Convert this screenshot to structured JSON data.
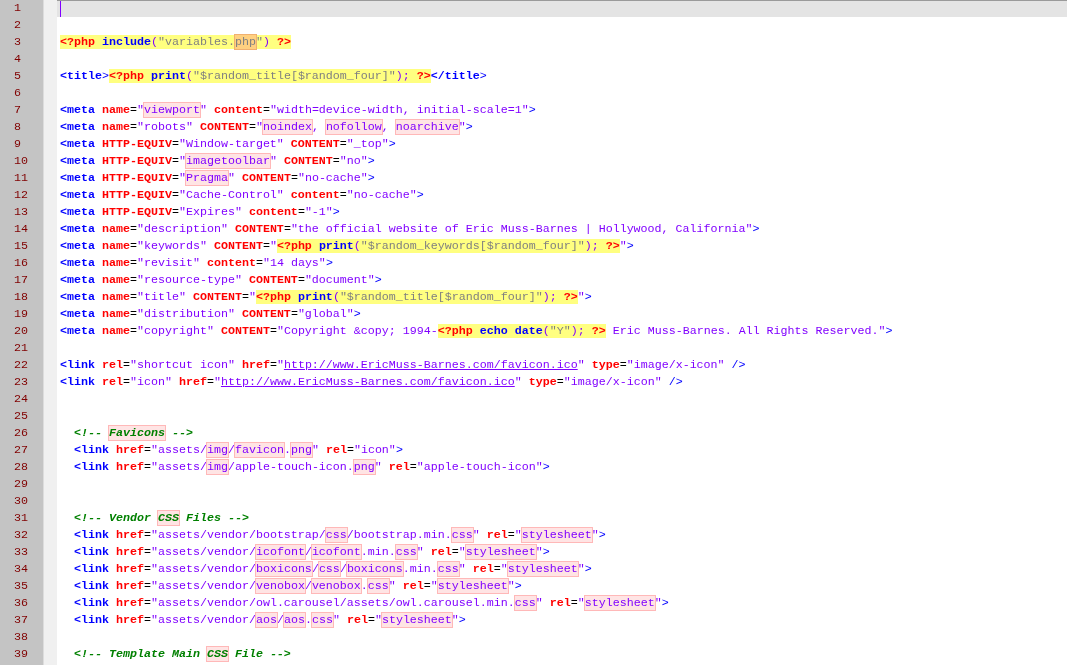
{
  "editor": {
    "lines": [
      {
        "number": "1",
        "current": true
      },
      {
        "number": "2",
        "current": false
      },
      {
        "number": "3",
        "current": false,
        "tokens": [
          {
            "text": "<?php ",
            "kind": "php"
          },
          {
            "text": "include",
            "kind": "php_kw"
          },
          {
            "text": "(",
            "kind": "php_punct"
          },
          {
            "text": "\"variables.",
            "kind": "php_str"
          },
          {
            "text": "php",
            "kind": "php_flag"
          },
          {
            "text": "\"",
            "kind": "php_str"
          },
          {
            "text": ") ",
            "kind": "php_punct"
          },
          {
            "text": "?>",
            "kind": "php"
          }
        ]
      },
      {
        "number": "4",
        "current": false
      },
      {
        "number": "5",
        "current": false,
        "tokens": [
          {
            "text": "<title",
            "kind": "tag"
          },
          {
            "text": ">",
            "kind": "punct"
          },
          {
            "text": "<?php ",
            "kind": "php"
          },
          {
            "text": "print",
            "kind": "php_kw"
          },
          {
            "text": "(",
            "kind": "php_punct"
          },
          {
            "text": "\"$random_title[$random_four]\"",
            "kind": "php_str"
          },
          {
            "text": "); ",
            "kind": "php_punct"
          },
          {
            "text": "?>",
            "kind": "php"
          },
          {
            "text": "</title",
            "kind": "tag"
          },
          {
            "text": ">",
            "kind": "punct"
          }
        ]
      },
      {
        "number": "6",
        "current": false
      },
      {
        "number": "7",
        "current": false,
        "tokens": [
          {
            "text": "<meta",
            "kind": "tag"
          },
          {
            "text": " name",
            "kind": "attr"
          },
          {
            "text": "=",
            "kind": "eq"
          },
          {
            "text": "\"",
            "kind": "val"
          },
          {
            "text": "viewport",
            "kind": "flag"
          },
          {
            "text": "\"",
            "kind": "val"
          },
          {
            "text": " content",
            "kind": "attr"
          },
          {
            "text": "=",
            "kind": "eq"
          },
          {
            "text": "\"width=device-width, initial-scale=1\"",
            "kind": "val"
          },
          {
            "text": ">",
            "kind": "punct"
          }
        ]
      },
      {
        "number": "8",
        "current": false,
        "tokens": [
          {
            "text": "<meta",
            "kind": "tag"
          },
          {
            "text": " name",
            "kind": "attr"
          },
          {
            "text": "=",
            "kind": "eq"
          },
          {
            "text": "\"robots\"",
            "kind": "val"
          },
          {
            "text": " CONTENT",
            "kind": "attr"
          },
          {
            "text": "=",
            "kind": "eq"
          },
          {
            "text": "\"",
            "kind": "val"
          },
          {
            "text": "noindex",
            "kind": "flag"
          },
          {
            "text": ", ",
            "kind": "val"
          },
          {
            "text": "nofollow",
            "kind": "flag"
          },
          {
            "text": ", ",
            "kind": "val"
          },
          {
            "text": "noarchive",
            "kind": "flag"
          },
          {
            "text": "\"",
            "kind": "val"
          },
          {
            "text": ">",
            "kind": "punct"
          }
        ]
      },
      {
        "number": "9",
        "current": false,
        "tokens": [
          {
            "text": "<meta",
            "kind": "tag"
          },
          {
            "text": " HTTP-EQUIV",
            "kind": "attr"
          },
          {
            "text": "=",
            "kind": "eq"
          },
          {
            "text": "\"Window-target\"",
            "kind": "val"
          },
          {
            "text": " CONTENT",
            "kind": "attr"
          },
          {
            "text": "=",
            "kind": "eq"
          },
          {
            "text": "\"_top\"",
            "kind": "val"
          },
          {
            "text": ">",
            "kind": "punct"
          }
        ]
      },
      {
        "number": "10",
        "current": false,
        "tokens": [
          {
            "text": "<meta",
            "kind": "tag"
          },
          {
            "text": " HTTP-EQUIV",
            "kind": "attr"
          },
          {
            "text": "=",
            "kind": "eq"
          },
          {
            "text": "\"",
            "kind": "val"
          },
          {
            "text": "imagetoolbar",
            "kind": "flag"
          },
          {
            "text": "\"",
            "kind": "val"
          },
          {
            "text": " CONTENT",
            "kind": "attr"
          },
          {
            "text": "=",
            "kind": "eq"
          },
          {
            "text": "\"no\"",
            "kind": "val"
          },
          {
            "text": ">",
            "kind": "punct"
          }
        ]
      },
      {
        "number": "11",
        "current": false,
        "tokens": [
          {
            "text": "<meta",
            "kind": "tag"
          },
          {
            "text": " HTTP-EQUIV",
            "kind": "attr"
          },
          {
            "text": "=",
            "kind": "eq"
          },
          {
            "text": "\"",
            "kind": "val"
          },
          {
            "text": "Pragma",
            "kind": "flag"
          },
          {
            "text": "\"",
            "kind": "val"
          },
          {
            "text": " CONTENT",
            "kind": "attr"
          },
          {
            "text": "=",
            "kind": "eq"
          },
          {
            "text": "\"no-cache\"",
            "kind": "val"
          },
          {
            "text": ">",
            "kind": "punct"
          }
        ]
      },
      {
        "number": "12",
        "current": false,
        "tokens": [
          {
            "text": "<meta",
            "kind": "tag"
          },
          {
            "text": " HTTP-EQUIV",
            "kind": "attr"
          },
          {
            "text": "=",
            "kind": "eq"
          },
          {
            "text": "\"Cache-Control\"",
            "kind": "val"
          },
          {
            "text": " content",
            "kind": "attr"
          },
          {
            "text": "=",
            "kind": "eq"
          },
          {
            "text": "\"no-cache\"",
            "kind": "val"
          },
          {
            "text": ">",
            "kind": "punct"
          }
        ]
      },
      {
        "number": "13",
        "current": false,
        "tokens": [
          {
            "text": "<meta",
            "kind": "tag"
          },
          {
            "text": " HTTP-EQUIV",
            "kind": "attr"
          },
          {
            "text": "=",
            "kind": "eq"
          },
          {
            "text": "\"Expires\"",
            "kind": "val"
          },
          {
            "text": " content",
            "kind": "attr"
          },
          {
            "text": "=",
            "kind": "eq"
          },
          {
            "text": "\"-1\"",
            "kind": "val"
          },
          {
            "text": ">",
            "kind": "punct"
          }
        ]
      },
      {
        "number": "14",
        "current": false,
        "tokens": [
          {
            "text": "<meta",
            "kind": "tag"
          },
          {
            "text": " name",
            "kind": "attr"
          },
          {
            "text": "=",
            "kind": "eq"
          },
          {
            "text": "\"description\"",
            "kind": "val"
          },
          {
            "text": " CONTENT",
            "kind": "attr"
          },
          {
            "text": "=",
            "kind": "eq"
          },
          {
            "text": "\"the official website of Eric Muss-Barnes | Hollywood, California\"",
            "kind": "val"
          },
          {
            "text": ">",
            "kind": "punct"
          }
        ]
      },
      {
        "number": "15",
        "current": false,
        "tokens": [
          {
            "text": "<meta",
            "kind": "tag"
          },
          {
            "text": " name",
            "kind": "attr"
          },
          {
            "text": "=",
            "kind": "eq"
          },
          {
            "text": "\"keywords\"",
            "kind": "val"
          },
          {
            "text": " CONTENT",
            "kind": "attr"
          },
          {
            "text": "=",
            "kind": "eq"
          },
          {
            "text": "\"",
            "kind": "val"
          },
          {
            "text": "<?php ",
            "kind": "php"
          },
          {
            "text": "print",
            "kind": "php_kw"
          },
          {
            "text": "(",
            "kind": "php_punct"
          },
          {
            "text": "\"$random_keywords[$random_four]\"",
            "kind": "php_str"
          },
          {
            "text": "); ",
            "kind": "php_punct"
          },
          {
            "text": "?>",
            "kind": "php"
          },
          {
            "text": "\"",
            "kind": "val"
          },
          {
            "text": ">",
            "kind": "punct"
          }
        ]
      },
      {
        "number": "16",
        "current": false,
        "tokens": [
          {
            "text": "<meta",
            "kind": "tag"
          },
          {
            "text": " name",
            "kind": "attr"
          },
          {
            "text": "=",
            "kind": "eq"
          },
          {
            "text": "\"revisit\"",
            "kind": "val"
          },
          {
            "text": " content",
            "kind": "attr"
          },
          {
            "text": "=",
            "kind": "eq"
          },
          {
            "text": "\"14 days\"",
            "kind": "val"
          },
          {
            "text": ">",
            "kind": "punct"
          }
        ]
      },
      {
        "number": "17",
        "current": false,
        "tokens": [
          {
            "text": "<meta",
            "kind": "tag"
          },
          {
            "text": " name",
            "kind": "attr"
          },
          {
            "text": "=",
            "kind": "eq"
          },
          {
            "text": "\"resource-type\"",
            "kind": "val"
          },
          {
            "text": " CONTENT",
            "kind": "attr"
          },
          {
            "text": "=",
            "kind": "eq"
          },
          {
            "text": "\"document\"",
            "kind": "val"
          },
          {
            "text": ">",
            "kind": "punct"
          }
        ]
      },
      {
        "number": "18",
        "current": false,
        "tokens": [
          {
            "text": "<meta",
            "kind": "tag"
          },
          {
            "text": " name",
            "kind": "attr"
          },
          {
            "text": "=",
            "kind": "eq"
          },
          {
            "text": "\"title\"",
            "kind": "val"
          },
          {
            "text": " CONTENT",
            "kind": "attr"
          },
          {
            "text": "=",
            "kind": "eq"
          },
          {
            "text": "\"",
            "kind": "val"
          },
          {
            "text": "<?php ",
            "kind": "php"
          },
          {
            "text": "print",
            "kind": "php_kw"
          },
          {
            "text": "(",
            "kind": "php_punct"
          },
          {
            "text": "\"$random_title[$random_four]\"",
            "kind": "php_str"
          },
          {
            "text": "); ",
            "kind": "php_punct"
          },
          {
            "text": "?>",
            "kind": "php"
          },
          {
            "text": "\"",
            "kind": "val"
          },
          {
            "text": ">",
            "kind": "punct"
          }
        ]
      },
      {
        "number": "19",
        "current": false,
        "tokens": [
          {
            "text": "<meta",
            "kind": "tag"
          },
          {
            "text": " name",
            "kind": "attr"
          },
          {
            "text": "=",
            "kind": "eq"
          },
          {
            "text": "\"distribution\"",
            "kind": "val"
          },
          {
            "text": " CONTENT",
            "kind": "attr"
          },
          {
            "text": "=",
            "kind": "eq"
          },
          {
            "text": "\"global\"",
            "kind": "val"
          },
          {
            "text": ">",
            "kind": "punct"
          }
        ]
      },
      {
        "number": "20",
        "current": false,
        "tokens": [
          {
            "text": "<meta",
            "kind": "tag"
          },
          {
            "text": " name",
            "kind": "attr"
          },
          {
            "text": "=",
            "kind": "eq"
          },
          {
            "text": "\"copyright\"",
            "kind": "val"
          },
          {
            "text": " CONTENT",
            "kind": "attr"
          },
          {
            "text": "=",
            "kind": "eq"
          },
          {
            "text": "\"Copyright &copy; 1994-",
            "kind": "val"
          },
          {
            "text": "<?php ",
            "kind": "php"
          },
          {
            "text": "echo date",
            "kind": "php_kw"
          },
          {
            "text": "(",
            "kind": "php_punct"
          },
          {
            "text": "\"Y\"",
            "kind": "php_str"
          },
          {
            "text": "); ",
            "kind": "php_punct"
          },
          {
            "text": "?>",
            "kind": "php"
          },
          {
            "text": " Eric Muss-Barnes. All Rights Reserved.\"",
            "kind": "val"
          },
          {
            "text": ">",
            "kind": "punct"
          }
        ]
      },
      {
        "number": "21",
        "current": false
      },
      {
        "number": "22",
        "current": false,
        "tokens": [
          {
            "text": "<link",
            "kind": "tag"
          },
          {
            "text": " rel",
            "kind": "attr"
          },
          {
            "text": "=",
            "kind": "eq"
          },
          {
            "text": "\"shortcut icon\"",
            "kind": "val"
          },
          {
            "text": " href",
            "kind": "attr"
          },
          {
            "text": "=",
            "kind": "eq"
          },
          {
            "text": "\"",
            "kind": "val"
          },
          {
            "text": "http://www.EricMuss-Barnes.com/favicon.ico",
            "kind": "url"
          },
          {
            "text": "\"",
            "kind": "val"
          },
          {
            "text": " type",
            "kind": "attr"
          },
          {
            "text": "=",
            "kind": "eq"
          },
          {
            "text": "\"image/x-icon\"",
            "kind": "val"
          },
          {
            "text": " />",
            "kind": "punct"
          }
        ]
      },
      {
        "number": "23",
        "current": false,
        "tokens": [
          {
            "text": "<link",
            "kind": "tag"
          },
          {
            "text": " rel",
            "kind": "attr"
          },
          {
            "text": "=",
            "kind": "eq"
          },
          {
            "text": "\"icon\"",
            "kind": "val"
          },
          {
            "text": " href",
            "kind": "attr"
          },
          {
            "text": "=",
            "kind": "eq"
          },
          {
            "text": "\"",
            "kind": "val"
          },
          {
            "text": "http://www.EricMuss-Barnes.com/favicon.ico",
            "kind": "url"
          },
          {
            "text": "\"",
            "kind": "val"
          },
          {
            "text": " type",
            "kind": "attr"
          },
          {
            "text": "=",
            "kind": "eq"
          },
          {
            "text": "\"image/x-icon\"",
            "kind": "val"
          },
          {
            "text": " />",
            "kind": "punct"
          }
        ]
      },
      {
        "number": "24",
        "current": false
      },
      {
        "number": "25",
        "current": false
      },
      {
        "number": "26",
        "current": false,
        "indented": true,
        "tokens": [
          {
            "text": "<!-- ",
            "kind": "comment"
          },
          {
            "text": "Favicons",
            "kind": "comment_flag"
          },
          {
            "text": " -->",
            "kind": "comment"
          }
        ]
      },
      {
        "number": "27",
        "current": false,
        "indented": true,
        "tokens": [
          {
            "text": "<link",
            "kind": "tag"
          },
          {
            "text": " href",
            "kind": "attr"
          },
          {
            "text": "=",
            "kind": "eq"
          },
          {
            "text": "\"assets/",
            "kind": "val"
          },
          {
            "text": "img",
            "kind": "flag"
          },
          {
            "text": "/",
            "kind": "val"
          },
          {
            "text": "favicon",
            "kind": "flag"
          },
          {
            "text": ".",
            "kind": "val"
          },
          {
            "text": "png",
            "kind": "flag"
          },
          {
            "text": "\"",
            "kind": "val"
          },
          {
            "text": " rel",
            "kind": "attr"
          },
          {
            "text": "=",
            "kind": "eq"
          },
          {
            "text": "\"icon\"",
            "kind": "val"
          },
          {
            "text": ">",
            "kind": "punct"
          }
        ]
      },
      {
        "number": "28",
        "current": false,
        "indented": true,
        "tokens": [
          {
            "text": "<link",
            "kind": "tag"
          },
          {
            "text": " href",
            "kind": "attr"
          },
          {
            "text": "=",
            "kind": "eq"
          },
          {
            "text": "\"assets/",
            "kind": "val"
          },
          {
            "text": "img",
            "kind": "flag"
          },
          {
            "text": "/apple-touch-icon.",
            "kind": "val"
          },
          {
            "text": "png",
            "kind": "flag"
          },
          {
            "text": "\"",
            "kind": "val"
          },
          {
            "text": " rel",
            "kind": "attr"
          },
          {
            "text": "=",
            "kind": "eq"
          },
          {
            "text": "\"apple-touch-icon\"",
            "kind": "val"
          },
          {
            "text": ">",
            "kind": "punct"
          }
        ]
      },
      {
        "number": "29",
        "current": false
      },
      {
        "number": "30",
        "current": false
      },
      {
        "number": "31",
        "current": false,
        "indented": true,
        "tokens": [
          {
            "text": "<!-- Vendor ",
            "kind": "comment"
          },
          {
            "text": "CSS",
            "kind": "comment_flag"
          },
          {
            "text": " Files -->",
            "kind": "comment"
          }
        ]
      },
      {
        "number": "32",
        "current": false,
        "indented": true,
        "tokens": [
          {
            "text": "<link",
            "kind": "tag"
          },
          {
            "text": " href",
            "kind": "attr"
          },
          {
            "text": "=",
            "kind": "eq"
          },
          {
            "text": "\"assets/vendor/bootstrap/",
            "kind": "val"
          },
          {
            "text": "css",
            "kind": "flag"
          },
          {
            "text": "/bootstrap.min.",
            "kind": "val"
          },
          {
            "text": "css",
            "kind": "flag"
          },
          {
            "text": "\"",
            "kind": "val"
          },
          {
            "text": " rel",
            "kind": "attr"
          },
          {
            "text": "=",
            "kind": "eq"
          },
          {
            "text": "\"",
            "kind": "val"
          },
          {
            "text": "stylesheet",
            "kind": "flag"
          },
          {
            "text": "\"",
            "kind": "val"
          },
          {
            "text": ">",
            "kind": "punct"
          }
        ]
      },
      {
        "number": "33",
        "current": false,
        "indented": true,
        "tokens": [
          {
            "text": "<link",
            "kind": "tag"
          },
          {
            "text": " href",
            "kind": "attr"
          },
          {
            "text": "=",
            "kind": "eq"
          },
          {
            "text": "\"assets/vendor/",
            "kind": "val"
          },
          {
            "text": "icofont",
            "kind": "flag"
          },
          {
            "text": "/",
            "kind": "val"
          },
          {
            "text": "icofont",
            "kind": "flag"
          },
          {
            "text": ".min.",
            "kind": "val"
          },
          {
            "text": "css",
            "kind": "flag"
          },
          {
            "text": "\"",
            "kind": "val"
          },
          {
            "text": " rel",
            "kind": "attr"
          },
          {
            "text": "=",
            "kind": "eq"
          },
          {
            "text": "\"",
            "kind": "val"
          },
          {
            "text": "stylesheet",
            "kind": "flag"
          },
          {
            "text": "\"",
            "kind": "val"
          },
          {
            "text": ">",
            "kind": "punct"
          }
        ]
      },
      {
        "number": "34",
        "current": false,
        "indented": true,
        "tokens": [
          {
            "text": "<link",
            "kind": "tag"
          },
          {
            "text": " href",
            "kind": "attr"
          },
          {
            "text": "=",
            "kind": "eq"
          },
          {
            "text": "\"assets/vendor/",
            "kind": "val"
          },
          {
            "text": "boxicons",
            "kind": "flag"
          },
          {
            "text": "/",
            "kind": "val"
          },
          {
            "text": "css",
            "kind": "flag"
          },
          {
            "text": "/",
            "kind": "val"
          },
          {
            "text": "boxicons",
            "kind": "flag"
          },
          {
            "text": ".min.",
            "kind": "val"
          },
          {
            "text": "css",
            "kind": "flag"
          },
          {
            "text": "\"",
            "kind": "val"
          },
          {
            "text": " rel",
            "kind": "attr"
          },
          {
            "text": "=",
            "kind": "eq"
          },
          {
            "text": "\"",
            "kind": "val"
          },
          {
            "text": "stylesheet",
            "kind": "flag"
          },
          {
            "text": "\"",
            "kind": "val"
          },
          {
            "text": ">",
            "kind": "punct"
          }
        ]
      },
      {
        "number": "35",
        "current": false,
        "indented": true,
        "tokens": [
          {
            "text": "<link",
            "kind": "tag"
          },
          {
            "text": " href",
            "kind": "attr"
          },
          {
            "text": "=",
            "kind": "eq"
          },
          {
            "text": "\"assets/vendor/",
            "kind": "val"
          },
          {
            "text": "venobox",
            "kind": "flag"
          },
          {
            "text": "/",
            "kind": "val"
          },
          {
            "text": "venobox",
            "kind": "flag"
          },
          {
            "text": ".",
            "kind": "val"
          },
          {
            "text": "css",
            "kind": "flag"
          },
          {
            "text": "\"",
            "kind": "val"
          },
          {
            "text": " rel",
            "kind": "attr"
          },
          {
            "text": "=",
            "kind": "eq"
          },
          {
            "text": "\"",
            "kind": "val"
          },
          {
            "text": "stylesheet",
            "kind": "flag"
          },
          {
            "text": "\"",
            "kind": "val"
          },
          {
            "text": ">",
            "kind": "punct"
          }
        ]
      },
      {
        "number": "36",
        "current": false,
        "indented": true,
        "tokens": [
          {
            "text": "<link",
            "kind": "tag"
          },
          {
            "text": " href",
            "kind": "attr"
          },
          {
            "text": "=",
            "kind": "eq"
          },
          {
            "text": "\"assets/vendor/owl.carousel/assets/owl.carousel.min.",
            "kind": "val"
          },
          {
            "text": "css",
            "kind": "flag"
          },
          {
            "text": "\"",
            "kind": "val"
          },
          {
            "text": " rel",
            "kind": "attr"
          },
          {
            "text": "=",
            "kind": "eq"
          },
          {
            "text": "\"",
            "kind": "val"
          },
          {
            "text": "stylesheet",
            "kind": "flag"
          },
          {
            "text": "\"",
            "kind": "val"
          },
          {
            "text": ">",
            "kind": "punct"
          }
        ]
      },
      {
        "number": "37",
        "current": false,
        "indented": true,
        "tokens": [
          {
            "text": "<link",
            "kind": "tag"
          },
          {
            "text": " href",
            "kind": "attr"
          },
          {
            "text": "=",
            "kind": "eq"
          },
          {
            "text": "\"assets/vendor/",
            "kind": "val"
          },
          {
            "text": "aos",
            "kind": "flag"
          },
          {
            "text": "/",
            "kind": "val"
          },
          {
            "text": "aos",
            "kind": "flag"
          },
          {
            "text": ".",
            "kind": "val"
          },
          {
            "text": "css",
            "kind": "flag"
          },
          {
            "text": "\"",
            "kind": "val"
          },
          {
            "text": " rel",
            "kind": "attr"
          },
          {
            "text": "=",
            "kind": "eq"
          },
          {
            "text": "\"",
            "kind": "val"
          },
          {
            "text": "stylesheet",
            "kind": "flag"
          },
          {
            "text": "\"",
            "kind": "val"
          },
          {
            "text": ">",
            "kind": "punct"
          }
        ]
      },
      {
        "number": "38",
        "current": false
      },
      {
        "number": "39",
        "current": false,
        "indented": true,
        "tokens": [
          {
            "text": "<!-- Template Main ",
            "kind": "comment"
          },
          {
            "text": "CSS",
            "kind": "comment_flag"
          },
          {
            "text": " File -->",
            "kind": "comment"
          }
        ]
      }
    ]
  }
}
